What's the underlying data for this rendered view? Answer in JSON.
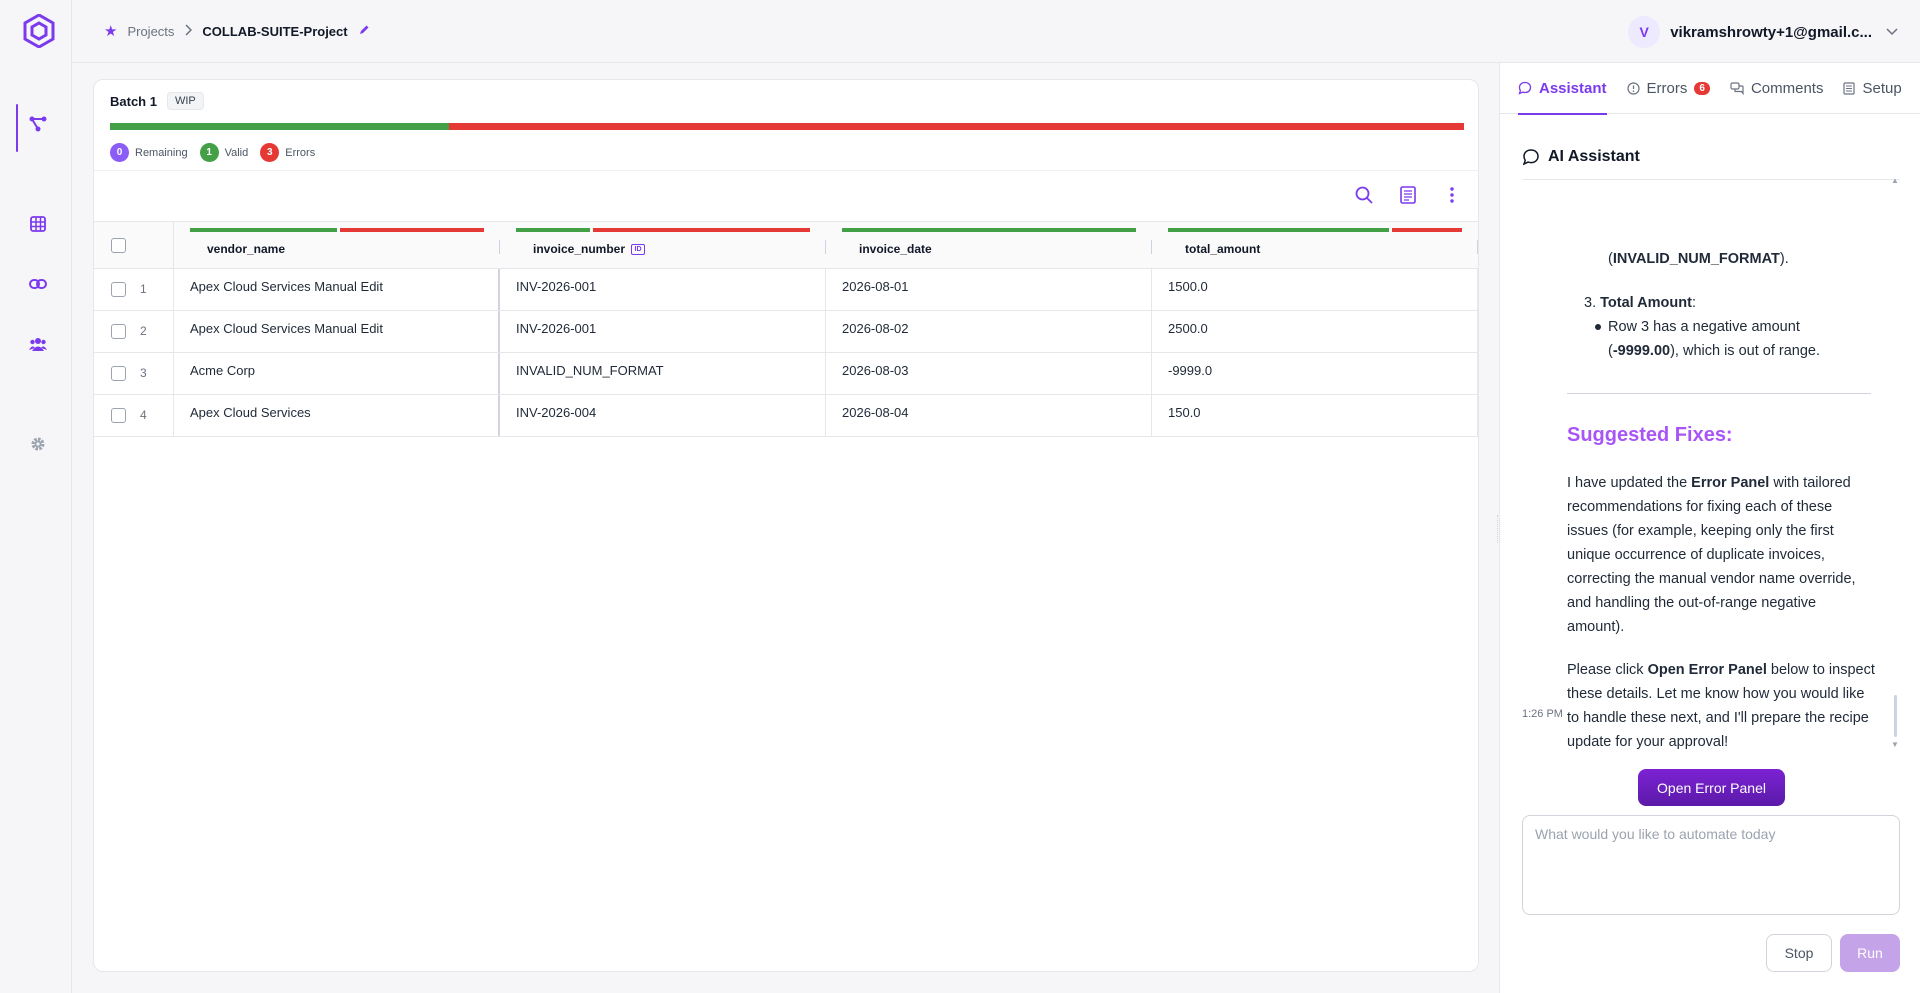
{
  "breadcrumb": {
    "root": "Projects",
    "current": "COLLAB-SUITE-Project"
  },
  "user": {
    "initial": "V",
    "email": "vikramshrowty+1@gmail.c..."
  },
  "batch": {
    "title": "Batch 1",
    "status": "WIP",
    "progress": {
      "valid_fraction": 0.25,
      "error_fraction": 0.75
    },
    "legend": [
      {
        "count": "0",
        "label": "Remaining",
        "color": "#8b5cf6"
      },
      {
        "count": "1",
        "label": "Valid",
        "color": "#43a047"
      },
      {
        "count": "3",
        "label": "Errors",
        "color": "#e53935"
      }
    ]
  },
  "table": {
    "columns": [
      "vendor_name",
      "invoice_number",
      "invoice_date",
      "total_amount"
    ],
    "rows": [
      {
        "num": "1",
        "vendor_name": "Apex Cloud Services Manual Edit",
        "invoice_number": "INV-2026-001",
        "invoice_date": "2026-08-01",
        "total_amount": "1500.0"
      },
      {
        "num": "2",
        "vendor_name": "Apex Cloud Services Manual Edit",
        "invoice_number": "INV-2026-001",
        "invoice_date": "2026-08-02",
        "total_amount": "2500.0"
      },
      {
        "num": "3",
        "vendor_name": "Acme Corp",
        "invoice_number": "INVALID_NUM_FORMAT",
        "invoice_date": "2026-08-03",
        "total_amount": "-9999.0"
      },
      {
        "num": "4",
        "vendor_name": "Apex Cloud Services",
        "invoice_number": "INV-2026-004",
        "invoice_date": "2026-08-04",
        "total_amount": "150.0"
      }
    ]
  },
  "panel": {
    "tabs": {
      "assistant": "Assistant",
      "errors": "Errors",
      "errors_count": "6",
      "comments": "Comments",
      "setup": "Setup"
    },
    "ai_title": "AI Assistant",
    "chat": {
      "line1_code": "INVALID_NUM_FORMAT",
      "line1_open": "(",
      "line1_close": ").",
      "item3_num": "3.",
      "item3_title": "Total Amount",
      "item3_colon": ":",
      "bullet_pre": "Row 3 has a negative amount (",
      "bullet_value": "-9999.00",
      "bullet_post": "), which is out of range.",
      "suggested_heading": "Suggested Fixes:",
      "p1_pre": "I have updated the ",
      "p1_bold": "Error Panel",
      "p1_post": " with tailored recommendations for fixing each of these issues (for example, keeping only the first unique occurrence of duplicate invoices, correcting the manual vendor name override, and handling the out-of-range negative amount).",
      "p2_pre": "Please click ",
      "p2_bold": "Open Error Panel",
      "p2_post": " below to inspect these details. Let me know how you would like to handle these next, and I'll prepare the recipe update for your approval!",
      "timestamp": "1:26 PM"
    },
    "open_error_panel": "Open Error Panel",
    "prompt_placeholder": "What would you like to automate today",
    "stop": "Stop",
    "run": "Run"
  },
  "colors": {
    "accent": "#7c3aed",
    "valid": "#43a047",
    "error": "#e53935"
  }
}
